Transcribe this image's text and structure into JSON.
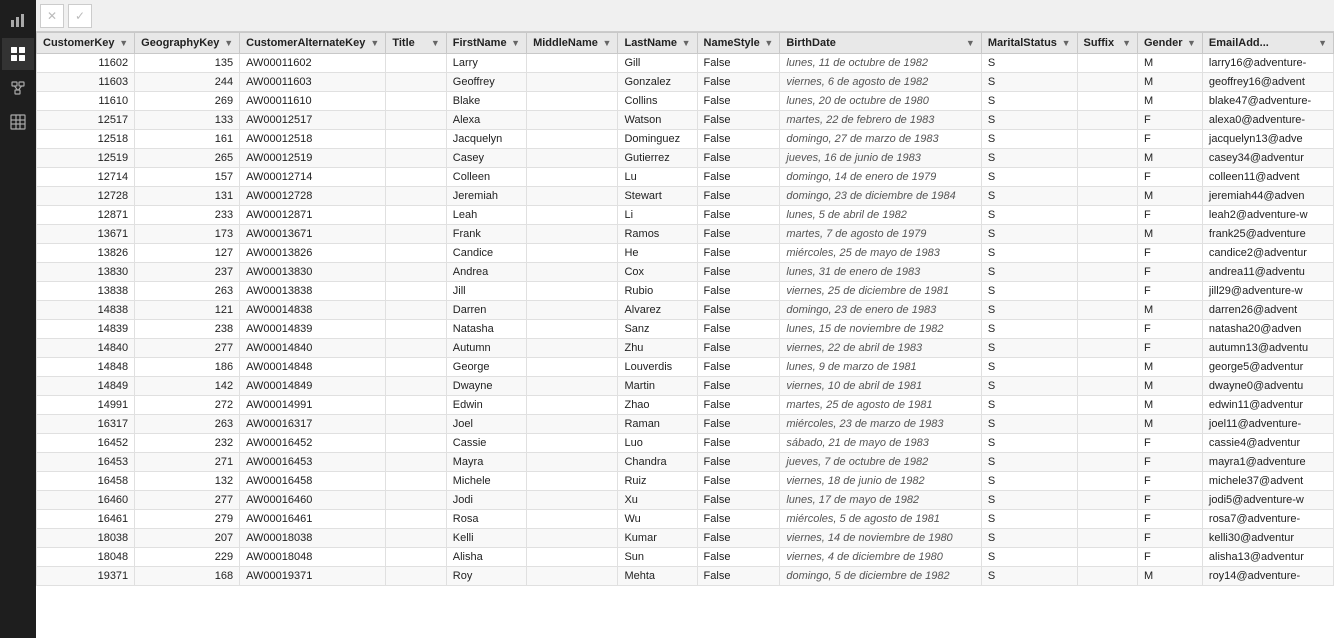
{
  "toolbar": {
    "close_label": "✕",
    "check_label": "✓"
  },
  "sidebar": {
    "icons": [
      {
        "name": "grid-icon",
        "symbol": "⊞",
        "active": false
      },
      {
        "name": "table-icon",
        "symbol": "▦",
        "active": true
      },
      {
        "name": "query-icon",
        "symbol": "⚡",
        "active": false
      },
      {
        "name": "connect-icon",
        "symbol": "⊗",
        "active": false
      }
    ]
  },
  "table": {
    "columns": [
      {
        "key": "CustomerKey",
        "label": "CustomerKey"
      },
      {
        "key": "GeographyKey",
        "label": "GeographyKey"
      },
      {
        "key": "CustomerAlternateKey",
        "label": "CustomerAlternateKey"
      },
      {
        "key": "Title",
        "label": "Title"
      },
      {
        "key": "FirstName",
        "label": "FirstName"
      },
      {
        "key": "MiddleName",
        "label": "MiddleName"
      },
      {
        "key": "LastName",
        "label": "LastName"
      },
      {
        "key": "NameStyle",
        "label": "NameStyle"
      },
      {
        "key": "BirthDate",
        "label": "BirthDate"
      },
      {
        "key": "MaritalStatus",
        "label": "MaritalStatus"
      },
      {
        "key": "Suffix",
        "label": "Suffix"
      },
      {
        "key": "Gender",
        "label": "Gender"
      },
      {
        "key": "EmailAddress",
        "label": "EmailAdd..."
      }
    ],
    "rows": [
      {
        "CustomerKey": "11602",
        "GeographyKey": "135",
        "CustomerAlternateKey": "AW00011602",
        "Title": "",
        "FirstName": "Larry",
        "MiddleName": "",
        "LastName": "Gill",
        "NameStyle": "False",
        "BirthDate": "lunes, 11 de octubre de 1982",
        "MaritalStatus": "S",
        "Suffix": "",
        "Gender": "M",
        "EmailAddress": "larry16@adventure-"
      },
      {
        "CustomerKey": "11603",
        "GeographyKey": "244",
        "CustomerAlternateKey": "AW00011603",
        "Title": "",
        "FirstName": "Geoffrey",
        "MiddleName": "",
        "LastName": "Gonzalez",
        "NameStyle": "False",
        "BirthDate": "viernes, 6 de agosto de 1982",
        "MaritalStatus": "S",
        "Suffix": "",
        "Gender": "M",
        "EmailAddress": "geoffrey16@advent"
      },
      {
        "CustomerKey": "11610",
        "GeographyKey": "269",
        "CustomerAlternateKey": "AW00011610",
        "Title": "",
        "FirstName": "Blake",
        "MiddleName": "",
        "LastName": "Collins",
        "NameStyle": "False",
        "BirthDate": "lunes, 20 de octubre de 1980",
        "MaritalStatus": "S",
        "Suffix": "",
        "Gender": "M",
        "EmailAddress": "blake47@adventure-"
      },
      {
        "CustomerKey": "12517",
        "GeographyKey": "133",
        "CustomerAlternateKey": "AW00012517",
        "Title": "",
        "FirstName": "Alexa",
        "MiddleName": "",
        "LastName": "Watson",
        "NameStyle": "False",
        "BirthDate": "martes, 22 de febrero de 1983",
        "MaritalStatus": "S",
        "Suffix": "",
        "Gender": "F",
        "EmailAddress": "alexa0@adventure-"
      },
      {
        "CustomerKey": "12518",
        "GeographyKey": "161",
        "CustomerAlternateKey": "AW00012518",
        "Title": "",
        "FirstName": "Jacquelyn",
        "MiddleName": "",
        "LastName": "Dominguez",
        "NameStyle": "False",
        "BirthDate": "domingo, 27 de marzo de 1983",
        "MaritalStatus": "S",
        "Suffix": "",
        "Gender": "F",
        "EmailAddress": "jacquelyn13@adve"
      },
      {
        "CustomerKey": "12519",
        "GeographyKey": "265",
        "CustomerAlternateKey": "AW00012519",
        "Title": "",
        "FirstName": "Casey",
        "MiddleName": "",
        "LastName": "Gutierrez",
        "NameStyle": "False",
        "BirthDate": "jueves, 16 de junio de 1983",
        "MaritalStatus": "S",
        "Suffix": "",
        "Gender": "M",
        "EmailAddress": "casey34@adventur"
      },
      {
        "CustomerKey": "12714",
        "GeographyKey": "157",
        "CustomerAlternateKey": "AW00012714",
        "Title": "",
        "FirstName": "Colleen",
        "MiddleName": "",
        "LastName": "Lu",
        "NameStyle": "False",
        "BirthDate": "domingo, 14 de enero de 1979",
        "MaritalStatus": "S",
        "Suffix": "",
        "Gender": "F",
        "EmailAddress": "colleen11@advent"
      },
      {
        "CustomerKey": "12728",
        "GeographyKey": "131",
        "CustomerAlternateKey": "AW00012728",
        "Title": "",
        "FirstName": "Jeremiah",
        "MiddleName": "",
        "LastName": "Stewart",
        "NameStyle": "False",
        "BirthDate": "domingo, 23 de diciembre de 1984",
        "MaritalStatus": "S",
        "Suffix": "",
        "Gender": "M",
        "EmailAddress": "jeremiah44@adven"
      },
      {
        "CustomerKey": "12871",
        "GeographyKey": "233",
        "CustomerAlternateKey": "AW00012871",
        "Title": "",
        "FirstName": "Leah",
        "MiddleName": "",
        "LastName": "Li",
        "NameStyle": "False",
        "BirthDate": "lunes, 5 de abril de 1982",
        "MaritalStatus": "S",
        "Suffix": "",
        "Gender": "F",
        "EmailAddress": "leah2@adventure-w"
      },
      {
        "CustomerKey": "13671",
        "GeographyKey": "173",
        "CustomerAlternateKey": "AW00013671",
        "Title": "",
        "FirstName": "Frank",
        "MiddleName": "",
        "LastName": "Ramos",
        "NameStyle": "False",
        "BirthDate": "martes, 7 de agosto de 1979",
        "MaritalStatus": "S",
        "Suffix": "",
        "Gender": "M",
        "EmailAddress": "frank25@adventure"
      },
      {
        "CustomerKey": "13826",
        "GeographyKey": "127",
        "CustomerAlternateKey": "AW00013826",
        "Title": "",
        "FirstName": "Candice",
        "MiddleName": "",
        "LastName": "He",
        "NameStyle": "False",
        "BirthDate": "miércoles, 25 de mayo de 1983",
        "MaritalStatus": "S",
        "Suffix": "",
        "Gender": "F",
        "EmailAddress": "candice2@adventur"
      },
      {
        "CustomerKey": "13830",
        "GeographyKey": "237",
        "CustomerAlternateKey": "AW00013830",
        "Title": "",
        "FirstName": "Andrea",
        "MiddleName": "",
        "LastName": "Cox",
        "NameStyle": "False",
        "BirthDate": "lunes, 31 de enero de 1983",
        "MaritalStatus": "S",
        "Suffix": "",
        "Gender": "F",
        "EmailAddress": "andrea11@adventu"
      },
      {
        "CustomerKey": "13838",
        "GeographyKey": "263",
        "CustomerAlternateKey": "AW00013838",
        "Title": "",
        "FirstName": "Jill",
        "MiddleName": "",
        "LastName": "Rubio",
        "NameStyle": "False",
        "BirthDate": "viernes, 25 de diciembre de 1981",
        "MaritalStatus": "S",
        "Suffix": "",
        "Gender": "F",
        "EmailAddress": "jill29@adventure-w"
      },
      {
        "CustomerKey": "14838",
        "GeographyKey": "121",
        "CustomerAlternateKey": "AW00014838",
        "Title": "",
        "FirstName": "Darren",
        "MiddleName": "",
        "LastName": "Alvarez",
        "NameStyle": "False",
        "BirthDate": "domingo, 23 de enero de 1983",
        "MaritalStatus": "S",
        "Suffix": "",
        "Gender": "M",
        "EmailAddress": "darren26@advent"
      },
      {
        "CustomerKey": "14839",
        "GeographyKey": "238",
        "CustomerAlternateKey": "AW00014839",
        "Title": "",
        "FirstName": "Natasha",
        "MiddleName": "",
        "LastName": "Sanz",
        "NameStyle": "False",
        "BirthDate": "lunes, 15 de noviembre de 1982",
        "MaritalStatus": "S",
        "Suffix": "",
        "Gender": "F",
        "EmailAddress": "natasha20@adven"
      },
      {
        "CustomerKey": "14840",
        "GeographyKey": "277",
        "CustomerAlternateKey": "AW00014840",
        "Title": "",
        "FirstName": "Autumn",
        "MiddleName": "",
        "LastName": "Zhu",
        "NameStyle": "False",
        "BirthDate": "viernes, 22 de abril de 1983",
        "MaritalStatus": "S",
        "Suffix": "",
        "Gender": "F",
        "EmailAddress": "autumn13@adventu"
      },
      {
        "CustomerKey": "14848",
        "GeographyKey": "186",
        "CustomerAlternateKey": "AW00014848",
        "Title": "",
        "FirstName": "George",
        "MiddleName": "",
        "LastName": "Louverdis",
        "NameStyle": "False",
        "BirthDate": "lunes, 9 de marzo de 1981",
        "MaritalStatus": "S",
        "Suffix": "",
        "Gender": "M",
        "EmailAddress": "george5@adventur"
      },
      {
        "CustomerKey": "14849",
        "GeographyKey": "142",
        "CustomerAlternateKey": "AW00014849",
        "Title": "",
        "FirstName": "Dwayne",
        "MiddleName": "",
        "LastName": "Martin",
        "NameStyle": "False",
        "BirthDate": "viernes, 10 de abril de 1981",
        "MaritalStatus": "S",
        "Suffix": "",
        "Gender": "M",
        "EmailAddress": "dwayne0@adventu"
      },
      {
        "CustomerKey": "14991",
        "GeographyKey": "272",
        "CustomerAlternateKey": "AW00014991",
        "Title": "",
        "FirstName": "Edwin",
        "MiddleName": "",
        "LastName": "Zhao",
        "NameStyle": "False",
        "BirthDate": "martes, 25 de agosto de 1981",
        "MaritalStatus": "S",
        "Suffix": "",
        "Gender": "M",
        "EmailAddress": "edwin11@adventur"
      },
      {
        "CustomerKey": "16317",
        "GeographyKey": "263",
        "CustomerAlternateKey": "AW00016317",
        "Title": "",
        "FirstName": "Joel",
        "MiddleName": "",
        "LastName": "Raman",
        "NameStyle": "False",
        "BirthDate": "miércoles, 23 de marzo de 1983",
        "MaritalStatus": "S",
        "Suffix": "",
        "Gender": "M",
        "EmailAddress": "joel11@adventure-"
      },
      {
        "CustomerKey": "16452",
        "GeographyKey": "232",
        "CustomerAlternateKey": "AW00016452",
        "Title": "",
        "FirstName": "Cassie",
        "MiddleName": "",
        "LastName": "Luo",
        "NameStyle": "False",
        "BirthDate": "sábado, 21 de mayo de 1983",
        "MaritalStatus": "S",
        "Suffix": "",
        "Gender": "F",
        "EmailAddress": "cassie4@adventur"
      },
      {
        "CustomerKey": "16453",
        "GeographyKey": "271",
        "CustomerAlternateKey": "AW00016453",
        "Title": "",
        "FirstName": "Mayra",
        "MiddleName": "",
        "LastName": "Chandra",
        "NameStyle": "False",
        "BirthDate": "jueves, 7 de octubre de 1982",
        "MaritalStatus": "S",
        "Suffix": "",
        "Gender": "F",
        "EmailAddress": "mayra1@adventure"
      },
      {
        "CustomerKey": "16458",
        "GeographyKey": "132",
        "CustomerAlternateKey": "AW00016458",
        "Title": "",
        "FirstName": "Michele",
        "MiddleName": "",
        "LastName": "Ruiz",
        "NameStyle": "False",
        "BirthDate": "viernes, 18 de junio de 1982",
        "MaritalStatus": "S",
        "Suffix": "",
        "Gender": "F",
        "EmailAddress": "michele37@advent"
      },
      {
        "CustomerKey": "16460",
        "GeographyKey": "277",
        "CustomerAlternateKey": "AW00016460",
        "Title": "",
        "FirstName": "Jodi",
        "MiddleName": "",
        "LastName": "Xu",
        "NameStyle": "False",
        "BirthDate": "lunes, 17 de mayo de 1982",
        "MaritalStatus": "S",
        "Suffix": "",
        "Gender": "F",
        "EmailAddress": "jodi5@adventure-w"
      },
      {
        "CustomerKey": "16461",
        "GeographyKey": "279",
        "CustomerAlternateKey": "AW00016461",
        "Title": "",
        "FirstName": "Rosa",
        "MiddleName": "",
        "LastName": "Wu",
        "NameStyle": "False",
        "BirthDate": "miércoles, 5 de agosto de 1981",
        "MaritalStatus": "S",
        "Suffix": "",
        "Gender": "F",
        "EmailAddress": "rosa7@adventure-"
      },
      {
        "CustomerKey": "18038",
        "GeographyKey": "207",
        "CustomerAlternateKey": "AW00018038",
        "Title": "",
        "FirstName": "Kelli",
        "MiddleName": "",
        "LastName": "Kumar",
        "NameStyle": "False",
        "BirthDate": "viernes, 14 de noviembre de 1980",
        "MaritalStatus": "S",
        "Suffix": "",
        "Gender": "F",
        "EmailAddress": "kelli30@adventur"
      },
      {
        "CustomerKey": "18048",
        "GeographyKey": "229",
        "CustomerAlternateKey": "AW00018048",
        "Title": "",
        "FirstName": "Alisha",
        "MiddleName": "",
        "LastName": "Sun",
        "NameStyle": "False",
        "BirthDate": "viernes, 4 de diciembre de 1980",
        "MaritalStatus": "S",
        "Suffix": "",
        "Gender": "F",
        "EmailAddress": "alisha13@adventur"
      },
      {
        "CustomerKey": "19371",
        "GeographyKey": "168",
        "CustomerAlternateKey": "AW00019371",
        "Title": "",
        "FirstName": "Roy",
        "MiddleName": "",
        "LastName": "Mehta",
        "NameStyle": "False",
        "BirthDate": "domingo, 5 de diciembre de 1982",
        "MaritalStatus": "S",
        "Suffix": "",
        "Gender": "M",
        "EmailAddress": "roy14@adventure-"
      }
    ]
  }
}
